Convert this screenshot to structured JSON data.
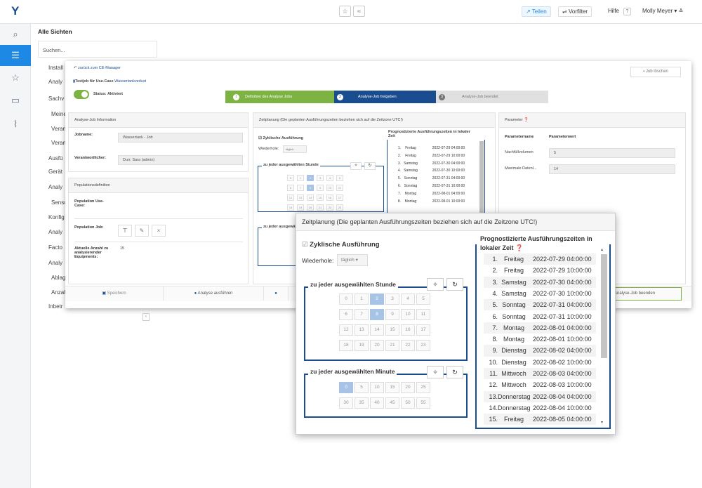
{
  "topbar": {
    "logo": "Y",
    "share": "Teilen",
    "prefilter": "Vorfilter",
    "help": "Hilfe",
    "help_q": "?",
    "user": "Molly Meyer"
  },
  "bg": {
    "title": "Alle Sichten",
    "search_placeholder": "Suchen...",
    "tree": [
      "Install",
      "Analy",
      "Sachv",
      "Meine",
      "Veran",
      "Veran",
      "Ausfü",
      "Gerät",
      "Analy",
      "Senso",
      "Konfig",
      "Analy",
      "Facto",
      "Analy",
      "Ablag",
      "Anzah",
      "Inbetr"
    ]
  },
  "dialog": {
    "back_link": "zurück zum CE-Manager",
    "delete_job": "Job löschen",
    "title_prefix": "Testjob für Use-Case",
    "title_link": "Wassertankverlust",
    "status": "Status: Aktiviert",
    "steps": [
      {
        "n": "1",
        "label": "Definition des Analyse Jobs"
      },
      {
        "n": "2",
        "label": "Analyse-Job freigeben"
      },
      {
        "n": "3",
        "label": "Analyse-Job beendet"
      }
    ],
    "info_head": "Analyse-Job Information",
    "jobname_label": "Jobname:",
    "jobname": "Wassertank - Job",
    "owner_label": "Verantwortlicher:",
    "owner": "Durr, Sara (admin)",
    "pop_head": "Populationsdefinition",
    "pop_use_case": "Population Use-Case:",
    "pop_job": "Population Job:",
    "count_label": "Aktuelle Anzahl zu analysierender Equipments:",
    "count": "15",
    "sched_head": "Zeitplanung (Die geplanten Ausführungszeiten beziehen sich auf die Zeitzone UTC!)",
    "param_head": "Parameter",
    "param_name_col": "Parametername",
    "param_value_col": "Parameterwert",
    "params": [
      {
        "name": "Nachfüllvolumen",
        "value": "5"
      },
      {
        "name": "Maximale Datenl...",
        "value": "14"
      }
    ],
    "save": "Speichern",
    "run": "Analyse ausführen",
    "end_job": "Analyse-Job beenden"
  },
  "popup": {
    "title": "Zeitplanung (Die geplanten Ausführungszeiten beziehen sich auf die Zeitzone UTC!)",
    "cyclic": "Zyklische Ausführung",
    "repeat_label": "Wiederhole:",
    "repeat_value": "täglich",
    "hour_legend": "zu jeder ausgewählten Stunde",
    "minute_legend": "zu jeder ausgewählten Minute",
    "forecast_title": "Prognostizierte Ausführungszeiten in lokaler Zeit",
    "hours": [
      "0",
      "1",
      "2",
      "3",
      "4",
      "5",
      "6",
      "7",
      "8",
      "9",
      "10",
      "11",
      "12",
      "13",
      "14",
      "15",
      "16",
      "17",
      "18",
      "19",
      "20",
      "21",
      "22",
      "23"
    ],
    "selected_hours": [
      "2",
      "8"
    ],
    "minutes": [
      "0",
      "5",
      "10",
      "15",
      "20",
      "25",
      "30",
      "35",
      "40",
      "45",
      "50",
      "55"
    ],
    "selected_minutes": [
      "0"
    ],
    "forecast": [
      {
        "n": "1.",
        "day": "Freitag",
        "ts": "2022-07-29 04:00:00"
      },
      {
        "n": "2.",
        "day": "Freitag",
        "ts": "2022-07-29 10:00:00"
      },
      {
        "n": "3.",
        "day": "Samstag",
        "ts": "2022-07-30 04:00:00"
      },
      {
        "n": "4.",
        "day": "Samstag",
        "ts": "2022-07-30 10:00:00"
      },
      {
        "n": "5.",
        "day": "Sonntag",
        "ts": "2022-07-31 04:00:00"
      },
      {
        "n": "6.",
        "day": "Sonntag",
        "ts": "2022-07-31 10:00:00"
      },
      {
        "n": "7.",
        "day": "Montag",
        "ts": "2022-08-01 04:00:00"
      },
      {
        "n": "8.",
        "day": "Montag",
        "ts": "2022-08-01 10:00:00"
      },
      {
        "n": "9.",
        "day": "Dienstag",
        "ts": "2022-08-02 04:00:00"
      },
      {
        "n": "10.",
        "day": "Dienstag",
        "ts": "2022-08-02 10:00:00"
      },
      {
        "n": "11.",
        "day": "Mittwoch",
        "ts": "2022-08-03 04:00:00"
      },
      {
        "n": "12.",
        "day": "Mittwoch",
        "ts": "2022-08-03 10:00:00"
      },
      {
        "n": "13.",
        "day": "Donnerstag",
        "ts": "2022-08-04 04:00:00"
      },
      {
        "n": "14.",
        "day": "Donnerstag",
        "ts": "2022-08-04 10:00:00"
      },
      {
        "n": "15.",
        "day": "Freitag",
        "ts": "2022-08-05 04:00:00"
      }
    ]
  },
  "colors": {
    "accent": "#1e88e5",
    "step_active": "#7cb342",
    "step_current": "#1a4d8f",
    "step_inactive": "#bdbdbd"
  }
}
